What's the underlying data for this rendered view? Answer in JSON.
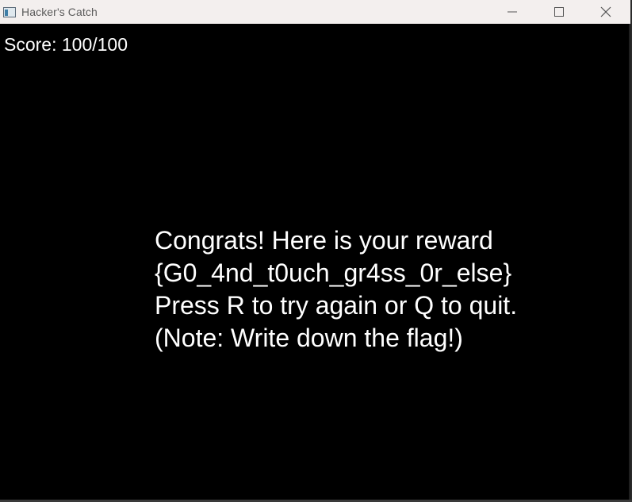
{
  "window": {
    "title": "Hacker's Catch",
    "icons": {
      "app": "app-window-icon",
      "minimize": "minimize-icon",
      "maximize": "maximize-icon",
      "close": "close-icon"
    }
  },
  "game": {
    "score_text": "Score: 100/100",
    "message_lines": [
      "Congrats! Here is your reward",
      "{G0_4nd_t0uch_gr4ss_0r_else}",
      "Press R to try again or Q to quit.",
      "(Note: Write down the flag!)"
    ]
  },
  "colors": {
    "background": "#000000",
    "text": "#ffffff",
    "titlebar": "#f3efee"
  }
}
